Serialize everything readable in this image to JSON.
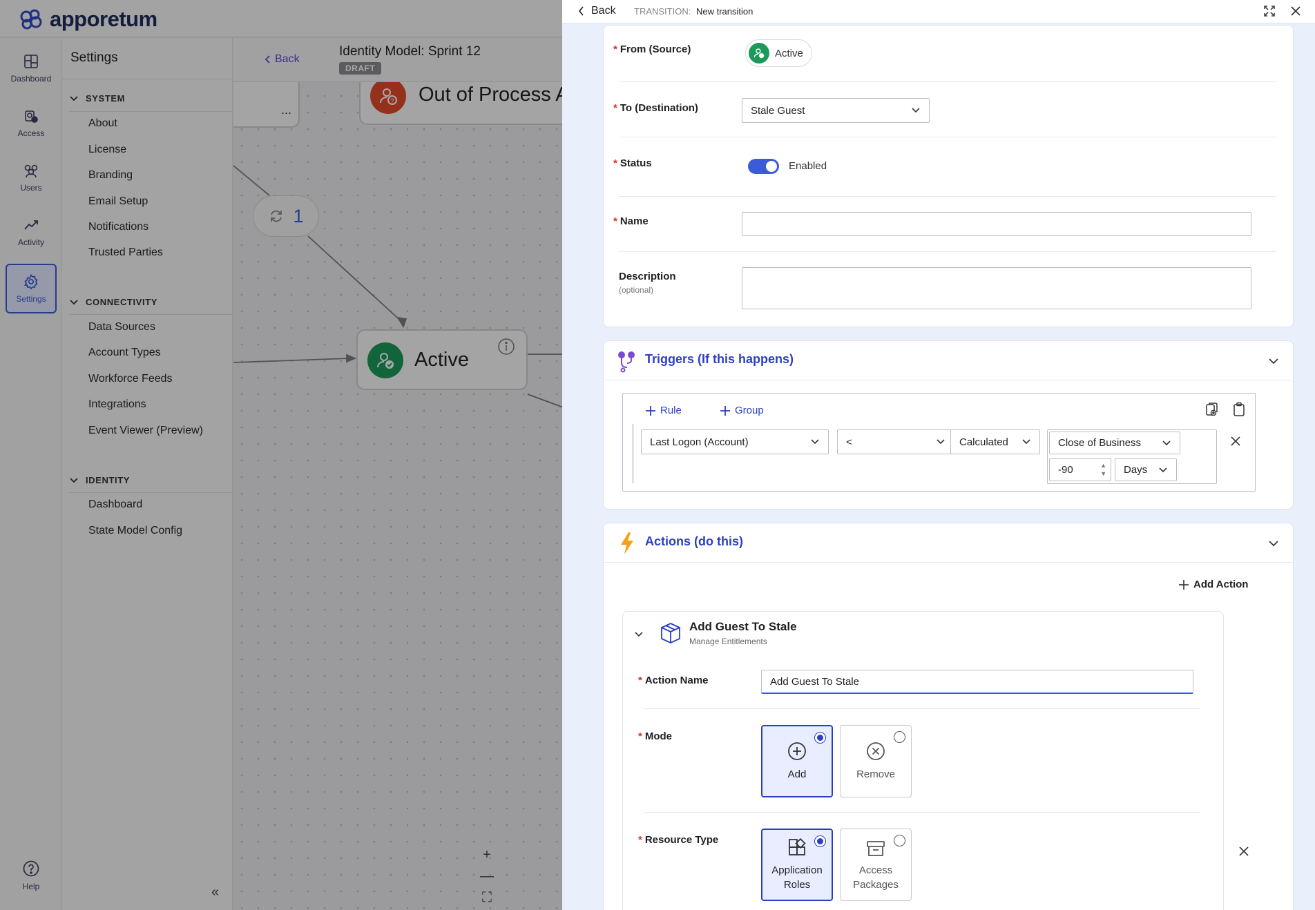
{
  "app": {
    "brand": "apporetum",
    "rail": [
      {
        "label": "Dashboard",
        "icon": "dashboard-icon"
      },
      {
        "label": "Access",
        "icon": "access-icon"
      },
      {
        "label": "Users",
        "icon": "users-icon"
      },
      {
        "label": "Activity",
        "icon": "activity-icon"
      },
      {
        "label": "Settings",
        "icon": "settings-icon"
      }
    ],
    "help_label": "Help"
  },
  "settings": {
    "title": "Settings",
    "sections": [
      {
        "title": "SYSTEM",
        "items": [
          "About",
          "License",
          "Branding",
          "Email Setup",
          "Notifications",
          "Trusted Parties"
        ]
      },
      {
        "title": "CONNECTIVITY",
        "items": [
          "Data Sources",
          "Account Types",
          "Workforce Feeds",
          "Integrations",
          "Event Viewer (Preview)"
        ]
      },
      {
        "title": "IDENTITY",
        "items": [
          "Dashboard",
          "State Model Config"
        ]
      }
    ]
  },
  "canvas": {
    "back_label": "Back",
    "model_title": "Identity Model: Sprint 12",
    "status_badge": "DRAFT",
    "node_out": "Out of Process A",
    "node_active": "Active",
    "transition_count": "1",
    "truncated_node_text": "..."
  },
  "drawer": {
    "back_label": "Back",
    "breadcrumb_prefix": "TRANSITION:",
    "breadcrumb_value": "New transition",
    "form": {
      "from_label": "From (Source)",
      "from_value": "Active",
      "to_label": "To (Destination)",
      "to_value": "Stale Guest",
      "status_label": "Status",
      "status_value": "Enabled",
      "name_label": "Name",
      "name_value": "",
      "description_label": "Description",
      "description_hint": "(optional)",
      "description_value": ""
    },
    "triggers": {
      "title": "Triggers (If this happens)",
      "add_rule": "Rule",
      "add_group": "Group",
      "attribute": "Last Logon (Account)",
      "operator": "<",
      "value_type": "Calculated",
      "base_date": "Close of Business",
      "offset": "-90",
      "unit": "Days"
    },
    "actions": {
      "title": "Actions (do this)",
      "add_action": "Add Action",
      "action_title": "Add Guest To Stale",
      "action_subtitle": "Manage Entitlements",
      "action_name_label": "Action Name",
      "action_name_value": "Add Guest To Stale",
      "mode_label": "Mode",
      "mode_add": "Add",
      "mode_remove": "Remove",
      "resource_type_label": "Resource Type",
      "rt_app_roles": "Application Roles",
      "rt_access_packages": "Access Packages"
    }
  },
  "colors": {
    "accent": "#3b5bdb",
    "section_title": "#2c3fc4",
    "required": "#d92d20",
    "active_green": "#1c9a5a",
    "out_of_process_red": "#e04b2b",
    "actions_orange": "#f0a21a"
  }
}
